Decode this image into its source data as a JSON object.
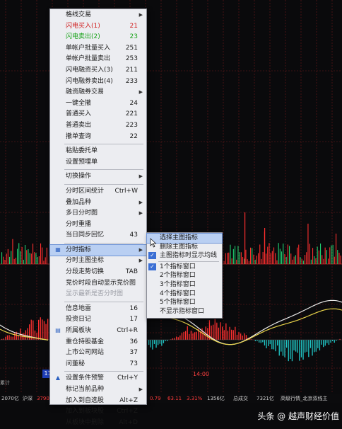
{
  "main_menu": {
    "items": [
      {
        "label": "格线交易",
        "value": "",
        "arrow": true,
        "style": "normal"
      },
      {
        "label": "闪电买入(1)",
        "value": "21",
        "arrow": false,
        "style": "red"
      },
      {
        "label": "闪电卖出(2)",
        "value": "23",
        "arrow": false,
        "style": "green"
      },
      {
        "label": "单帐户批量买入",
        "value": "251",
        "arrow": false,
        "style": "normal"
      },
      {
        "label": "单帐户批量卖出",
        "value": "253",
        "arrow": false,
        "style": "normal"
      },
      {
        "label": "闪电融资买入(3)",
        "value": "211",
        "arrow": false,
        "style": "normal"
      },
      {
        "label": "闪电融券卖出(4)",
        "value": "233",
        "arrow": false,
        "style": "normal"
      },
      {
        "label": "融资融券交易",
        "value": "",
        "arrow": true,
        "style": "normal"
      },
      {
        "label": "一键全撤",
        "value": "24",
        "arrow": false,
        "style": "normal"
      },
      {
        "label": "普通买入",
        "value": "221",
        "arrow": false,
        "style": "normal"
      },
      {
        "label": "普通卖出",
        "value": "223",
        "arrow": false,
        "style": "normal"
      },
      {
        "label": "撤单查询",
        "value": "22",
        "arrow": false,
        "style": "normal"
      },
      {
        "sep": true
      },
      {
        "label": "粘贴委托单",
        "value": "",
        "arrow": false,
        "style": "normal"
      },
      {
        "label": "设置预埋单",
        "value": "",
        "arrow": false,
        "style": "normal"
      },
      {
        "sep": true
      },
      {
        "label": "切换操作",
        "value": "",
        "arrow": true,
        "style": "normal"
      },
      {
        "sep": true
      },
      {
        "label": "分时区间统计",
        "value": "Ctrl+W",
        "arrow": false,
        "style": "normal"
      },
      {
        "label": "叠加品种",
        "value": "",
        "arrow": true,
        "style": "normal"
      },
      {
        "label": "多日分时图",
        "value": "",
        "arrow": true,
        "style": "normal"
      },
      {
        "label": "分时重播",
        "value": "",
        "arrow": false,
        "style": "normal"
      },
      {
        "label": "当日同步回忆",
        "value": "43",
        "arrow": false,
        "style": "normal"
      },
      {
        "sep": true
      },
      {
        "label": "分时指标",
        "value": "",
        "arrow": true,
        "style": "highlight",
        "icon": "chart-icon"
      },
      {
        "label": "分时主图坐标",
        "value": "",
        "arrow": true,
        "style": "normal"
      },
      {
        "label": "分段走势切换",
        "value": "TAB",
        "arrow": false,
        "style": "normal"
      },
      {
        "label": "竞价时段自动显示竞价图",
        "value": "",
        "arrow": false,
        "style": "normal"
      },
      {
        "label": "显示最新是否分时图",
        "value": "",
        "arrow": false,
        "style": "dim"
      },
      {
        "sep": true
      },
      {
        "label": "信息地雷",
        "value": "16",
        "arrow": false,
        "style": "normal"
      },
      {
        "label": "投资日记",
        "value": "17",
        "arrow": false,
        "style": "normal"
      },
      {
        "label": "所属板块",
        "value": "Ctrl+R",
        "arrow": false,
        "style": "normal",
        "icon": "grid-icon"
      },
      {
        "label": "重仓持股基金",
        "value": "36",
        "arrow": false,
        "style": "normal"
      },
      {
        "label": "上市公司网站",
        "value": "37",
        "arrow": false,
        "style": "normal"
      },
      {
        "label": "问董秘",
        "value": "73",
        "arrow": false,
        "style": "normal"
      },
      {
        "sep": true
      },
      {
        "label": "设置条件预警",
        "value": "Ctrl+Y",
        "arrow": false,
        "style": "normal",
        "icon": "alert-icon"
      },
      {
        "label": "标记当前品种",
        "value": "",
        "arrow": true,
        "style": "normal"
      },
      {
        "label": "加入到自选股",
        "value": "Alt+Z",
        "arrow": false,
        "style": "normal"
      },
      {
        "label": "加入到板块股",
        "value": "Ctrl+Z",
        "arrow": false,
        "style": "normal"
      },
      {
        "label": "从板块中删除",
        "value": "Alt+D",
        "arrow": false,
        "style": "normal"
      },
      {
        "sep": true
      },
      {
        "label": "相关网站链接",
        "value": "",
        "arrow": true,
        "style": "normal"
      }
    ]
  },
  "sub_menu": {
    "items": [
      {
        "label": "选择主图指标",
        "checked": false,
        "style": "highlight"
      },
      {
        "label": "删除主图指标",
        "checked": false,
        "style": "normal"
      },
      {
        "label": "主图指标时显示均线",
        "checked": true,
        "style": "normal"
      },
      {
        "sep": true
      },
      {
        "label": "1个指标窗口",
        "checked": true,
        "style": "normal"
      },
      {
        "label": "2个指标窗口",
        "checked": false,
        "style": "normal"
      },
      {
        "label": "3个指标窗口",
        "checked": false,
        "style": "normal"
      },
      {
        "label": "4个指标窗口",
        "checked": false,
        "style": "normal"
      },
      {
        "label": "5个指标窗口",
        "checked": false,
        "style": "normal"
      },
      {
        "label": "不显示指标窗口",
        "checked": false,
        "style": "normal"
      }
    ]
  },
  "chart": {
    "price_tag": "11.29",
    "time_label": "14:00",
    "left_label": "累计"
  },
  "status_bar": {
    "t1": "2070亿",
    "t2": "沪深",
    "t3": "3790.82",
    "t4": "0.79",
    "t5": "63.11",
    "t6": "3.31%",
    "t7": "1356亿",
    "t8": "总成交",
    "t9": "7321亿",
    "t10": "高级行情_北京双线主"
  },
  "watermark": {
    "prefix": "头条",
    "at": "@",
    "name": "越声财经价值"
  },
  "colors": {
    "up": "#ff3b3b",
    "down": "#1fbfbf",
    "menu_bg": "#ecedf1",
    "menu_highlight": "#b9cff2"
  }
}
